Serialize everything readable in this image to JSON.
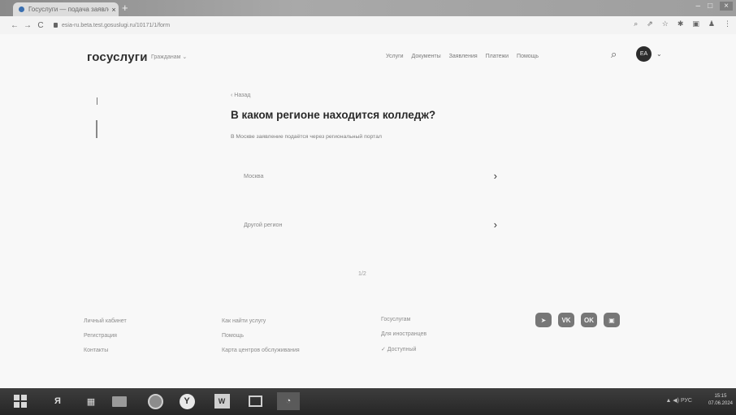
{
  "browser": {
    "tab_title": "Госуслуги — подача заявления",
    "tab_close": "×",
    "new_tab": "+",
    "back": "←",
    "forward": "→",
    "reload": "C",
    "url": "esia-ru.beta.test.gosuslugi.ru/10171/1/form",
    "toolbar_icons": [
      "search-icon",
      "share-icon",
      "bookmark-star-icon",
      "extensions-icon",
      "sidebar-icon",
      "profile-icon",
      "menu-icon"
    ],
    "window_controls": [
      "–",
      "□",
      "×"
    ]
  },
  "header": {
    "logo": "госуслуги",
    "role": "Гражданам ⌄",
    "nav": [
      "Услуги",
      "Документы",
      "Заявления",
      "Платежи",
      "Помощь"
    ],
    "user_initials": "ЕА",
    "user_chevron": "⌄"
  },
  "main": {
    "back": "‹ Назад",
    "title": "В каком регионе находится колледж?",
    "hint": "В Москве заявление подаётся через региональный портал",
    "options": [
      {
        "label": "Москва",
        "arrow": "›"
      },
      {
        "label": "Другой регион",
        "arrow": "›"
      }
    ],
    "loading": "1/2"
  },
  "footer": {
    "col1": [
      "Личный кабинет",
      "Регистрация",
      "Контакты"
    ],
    "col2": [
      "Как найти услугу",
      "Помощь",
      "Карта центров обслуживания"
    ],
    "col3": [
      "Госуслугам",
      "Для иностранцев",
      "✓ Доступный"
    ],
    "socials": [
      {
        "icon": "telegram-icon",
        "glyph": "➤"
      },
      {
        "icon": "vk-icon",
        "glyph": "VK"
      },
      {
        "icon": "odnoklassniki-icon",
        "glyph": "OK"
      },
      {
        "icon": "yandex-zen-icon",
        "glyph": "▣"
      }
    ]
  },
  "taskbar": {
    "yandex_label": "Я",
    "yandex_browser": "Y",
    "word": "W",
    "tray": "▲ ◀) РУС",
    "time": "15:15",
    "date": "07.06.2024"
  },
  "colors": {
    "page_bg": "#f8f8f8",
    "taskbar": "#2b2b2b",
    "social_icon_bg": "#777777"
  }
}
